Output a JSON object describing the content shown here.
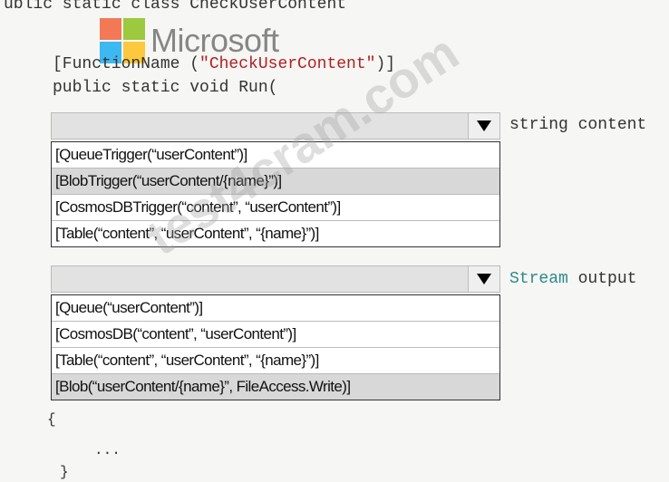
{
  "code": {
    "class_line": "ublic static class CheckUserContent",
    "attribute_prefix": "[FunctionName (",
    "attribute_value": "\"CheckUserContent\"",
    "attribute_suffix": ")]",
    "method_line": "public static void Run(",
    "open_brace": "{",
    "ellipsis": "...",
    "close_brace": "}"
  },
  "logo": {
    "text": "Microsoft"
  },
  "dropdown1": {
    "after_label": "string content",
    "options": [
      "[QueueTrigger(“userContent”)]",
      "[BlobTrigger(“userContent/{name}”)]",
      "[CosmosDBTrigger(“content”, “userContent”)]",
      "[Table(“content”, “userContent”, “{name}”)]"
    ],
    "selected_index": 1
  },
  "dropdown2": {
    "after_type": "Stream",
    "after_name": "output",
    "options": [
      "[Queue(“userContent”)]",
      "[CosmosDB(“content”, “userContent”)]",
      "[Table(“content”, “userContent”, “{name}”)]",
      "[Blob(“userContent/{name}”, FileAccess.Write)]"
    ],
    "selected_index": 3
  },
  "watermark": "test4cram.com",
  "colors": {
    "logo_red": "#f25022",
    "logo_green": "#7fba00",
    "logo_blue": "#00a4ef",
    "logo_yellow": "#ffb900"
  }
}
